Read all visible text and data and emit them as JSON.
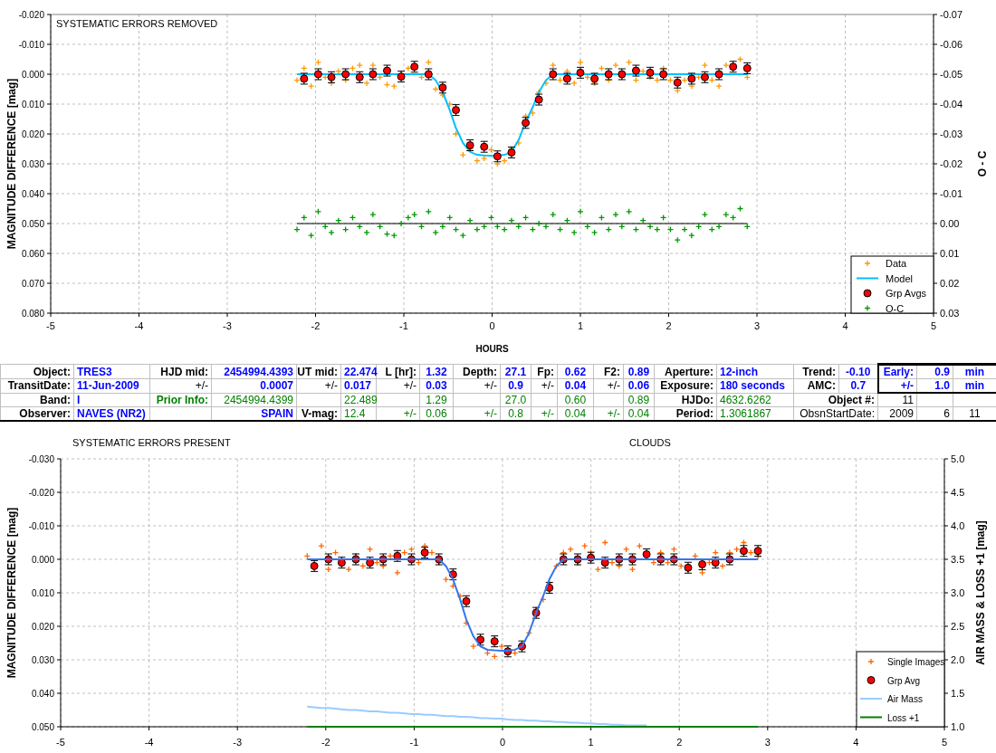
{
  "chart_top": {
    "chart_data": {
      "type": "scatter",
      "xlabel": "HOURS",
      "ylabel": "MAGNITUDE DIFFERENCE [mag]",
      "xlim": [
        -5,
        5
      ],
      "ylim": [
        0.08,
        -0.02
      ],
      "xticks": [
        -5,
        -4,
        -3,
        -2,
        -1,
        0,
        1,
        2,
        3,
        4,
        5
      ],
      "yticks": [
        {
          "value": -0.02,
          "label": "-0.020"
        },
        {
          "value": -0.01,
          "label": "-0.010"
        },
        {
          "value": 0,
          "label": "0.000"
        },
        {
          "value": 0.01,
          "label": "0.010"
        },
        {
          "value": 0.02,
          "label": "0.020"
        },
        {
          "value": 0.03,
          "label": "0.030"
        },
        {
          "value": 0.04,
          "label": "0.040"
        },
        {
          "value": 0.05,
          "label": "0.050"
        },
        {
          "value": 0.06,
          "label": "0.060"
        },
        {
          "value": 0.07,
          "label": "0.070"
        },
        {
          "value": 0.08,
          "label": "0.080"
        }
      ],
      "y2label": "O - C",
      "y2lim": [
        0.03,
        -0.07
      ],
      "y2ticks": [
        {
          "value": -0.07,
          "label": "-0.07"
        },
        {
          "value": -0.06,
          "label": "-0.06"
        },
        {
          "value": -0.05,
          "label": "-0.05"
        },
        {
          "value": -0.04,
          "label": "-0.04"
        },
        {
          "value": -0.03,
          "label": "-0.03"
        },
        {
          "value": -0.02,
          "label": "-0.02"
        },
        {
          "value": -0.01,
          "label": "-0.01"
        },
        {
          "value": 0,
          "label": "0.00"
        },
        {
          "value": 0.01,
          "label": "0.01"
        },
        {
          "value": 0.02,
          "label": "0.02"
        },
        {
          "value": 0.03,
          "label": "0.03"
        }
      ],
      "annotations": [
        {
          "text": "SYSTEMATIC ERRORS REMOVED"
        }
      ],
      "grid": true,
      "legend": true,
      "ref_lines": [
        {
          "axis": "y2",
          "value": 0
        }
      ],
      "x": [
        -2.21,
        -2.13,
        -2.05,
        -1.97,
        -1.89,
        -1.82,
        -1.74,
        -1.66,
        -1.58,
        -1.5,
        -1.42,
        -1.35,
        -1.27,
        -1.19,
        -1.11,
        -1.03,
        -0.95,
        -0.88,
        -0.8,
        -0.72,
        -0.64,
        -0.56,
        -0.48,
        -0.41,
        -0.33,
        -0.25,
        -0.17,
        -0.09,
        -0.01,
        0.06,
        0.14,
        0.22,
        0.3,
        0.38,
        0.46,
        0.53,
        0.61,
        0.69,
        0.77,
        0.85,
        0.93,
        1.0,
        1.08,
        1.16,
        1.24,
        1.32,
        1.4,
        1.47,
        1.55,
        1.63,
        1.71,
        1.79,
        1.87,
        1.94,
        2.02,
        2.1,
        2.18,
        2.26,
        2.34,
        2.41,
        2.49,
        2.57,
        2.65,
        2.73,
        2.81,
        2.89
      ],
      "series": [
        {
          "name": "Data",
          "type": "scatter",
          "marker": "plus",
          "color": "#ff9900",
          "values": [
            0.002,
            -0.002,
            0.004,
            -0.004,
            0.001,
            0.003,
            -0.001,
            0.002,
            -0.002,
            -0.003,
            0.003,
            -0.003,
            0.001,
            0.0035,
            0.004,
            0.0,
            -0.002,
            -0.003,
            0.001,
            -0.004,
            0.005,
            0.007,
            0.01,
            0.02,
            0.027,
            0.025,
            0.029,
            0.0282,
            0.0253,
            0.03,
            0.029,
            0.025,
            0.023,
            0.014,
            0.013,
            0.006,
            0.003,
            -0.003,
            0.002,
            -0.001,
            0.003,
            -0.004,
            0.001,
            0.003,
            -0.002,
            0.002,
            -0.003,
            0.001,
            -0.004,
            0.002,
            -0.001,
            0.001,
            0.002,
            -0.002,
            0.002,
            0.0055,
            0.002,
            0.004,
            0.001,
            -0.003,
            0.002,
            0.004,
            -0.003,
            -0.002,
            -0.005,
            0.001
          ]
        },
        {
          "name": "Model",
          "type": "line",
          "color": "#00bfff",
          "values": [
            0,
            0,
            0,
            0,
            0,
            0,
            0,
            0,
            0,
            0,
            0,
            0,
            0,
            0,
            0,
            0,
            0,
            0,
            0,
            0,
            0.002,
            0.006,
            0.012,
            0.018,
            0.023,
            0.026,
            0.027,
            0.0272,
            0.0273,
            0.0273,
            0.027,
            0.026,
            0.022,
            0.016,
            0.011,
            0.006,
            0.002,
            0,
            0,
            0,
            0,
            0,
            0,
            0,
            0,
            0,
            0,
            0,
            0,
            0,
            0,
            0,
            0,
            0,
            0,
            0,
            0,
            0,
            0,
            0,
            0,
            0,
            0,
            0,
            0,
            0
          ]
        },
        {
          "name": "Grp Avgs",
          "type": "scatter",
          "marker": "circle",
          "color": "#ff0000",
          "values": [
            null,
            0.0015,
            null,
            0,
            null,
            0.001,
            null,
            0,
            null,
            0.001,
            null,
            0,
            null,
            -0.0012,
            null,
            0.0008,
            null,
            -0.0025,
            null,
            0,
            null,
            0.0045,
            null,
            0.012,
            null,
            0.0238,
            null,
            0.0243,
            null,
            0.0275,
            null,
            0.0262,
            null,
            0.0163,
            null,
            0.0085,
            null,
            0,
            null,
            0.0015,
            null,
            -0.0005,
            null,
            0.0015,
            null,
            0,
            null,
            0,
            null,
            -0.0012,
            null,
            -0.0005,
            null,
            0,
            null,
            0.0028,
            null,
            0.0015,
            null,
            0.001,
            null,
            0,
            null,
            -0.0025,
            null,
            -0.002
          ]
        },
        {
          "name": "O-C",
          "type": "scatter",
          "marker": "plus",
          "axis": "y2",
          "color": "#009900",
          "values": [
            0.002,
            -0.002,
            0.004,
            -0.004,
            0.001,
            0.003,
            -0.001,
            0.002,
            -0.002,
            0.001,
            0.003,
            -0.003,
            0.001,
            0.0035,
            0.004,
            0.0,
            -0.002,
            -0.003,
            0.001,
            -0.004,
            0.003,
            0.001,
            -0.002,
            0.002,
            0.004,
            -0.001,
            0.002,
            0.001,
            -0.002,
            0.001,
            0.002,
            -0.001,
            0.001,
            -0.002,
            0.002,
            0.0,
            0.001,
            -0.003,
            0.002,
            -0.001,
            0.003,
            -0.004,
            0.001,
            0.003,
            -0.002,
            0.002,
            -0.003,
            0.001,
            -0.004,
            0.002,
            -0.001,
            0.001,
            0.002,
            -0.002,
            0.002,
            0.0055,
            0.002,
            0.004,
            0.001,
            -0.003,
            0.002,
            0.001,
            -0.003,
            -0.002,
            -0.005,
            0.001
          ]
        }
      ]
    }
  },
  "info_table": {
    "rows": [
      [
        {
          "text": "Object:",
          "kind": "label"
        },
        {
          "text": "TRES3",
          "kind": "value"
        },
        {
          "text": "HJD mid:",
          "kind": "label"
        },
        {
          "text": "2454994.4393",
          "kind": "value"
        },
        {
          "text": "UT mid:",
          "kind": "label"
        },
        {
          "text": "22.474",
          "kind": "value"
        },
        {
          "text": "L [hr]:",
          "kind": "label"
        },
        {
          "text": "1.32",
          "kind": "value"
        },
        {
          "text": "Depth:",
          "kind": "label"
        },
        {
          "text": "27.1",
          "kind": "value"
        },
        {
          "text": "Fp:",
          "kind": "label"
        },
        {
          "text": "0.62",
          "kind": "value"
        },
        {
          "text": "F2:",
          "kind": "label"
        },
        {
          "text": "0.89",
          "kind": "value"
        },
        {
          "text": "Aperture:",
          "kind": "label"
        },
        {
          "text": "12-inch",
          "kind": "value"
        },
        {
          "text": "Trend:",
          "kind": "label"
        },
        {
          "text": "-0.10",
          "kind": "value"
        },
        {
          "text": "Early:",
          "kind": "value",
          "boxed": true
        },
        {
          "text": "0.9",
          "kind": "value",
          "boxed": true
        },
        {
          "text": "min",
          "kind": "value",
          "boxed": true
        }
      ],
      [
        {
          "text": "TransitDate:",
          "kind": "label"
        },
        {
          "text": "11-Jun-2009",
          "kind": "value"
        },
        {
          "text": "+/-",
          "kind": "plain"
        },
        {
          "text": "0.0007",
          "kind": "value"
        },
        {
          "text": "+/-",
          "kind": "plain"
        },
        {
          "text": "0.017",
          "kind": "value"
        },
        {
          "text": "+/-",
          "kind": "plain"
        },
        {
          "text": "0.03",
          "kind": "value"
        },
        {
          "text": "+/-",
          "kind": "plain"
        },
        {
          "text": "0.9",
          "kind": "value"
        },
        {
          "text": "+/-",
          "kind": "plain"
        },
        {
          "text": "0.04",
          "kind": "value"
        },
        {
          "text": "+/-",
          "kind": "plain"
        },
        {
          "text": "0.06",
          "kind": "value"
        },
        {
          "text": "Exposure:",
          "kind": "label"
        },
        {
          "text": "180 seconds",
          "kind": "value"
        },
        {
          "text": "AMC:",
          "kind": "label"
        },
        {
          "text": "0.7",
          "kind": "value"
        },
        {
          "text": "+/-",
          "kind": "value",
          "boxed": true
        },
        {
          "text": "1.0",
          "kind": "value",
          "boxed": true
        },
        {
          "text": "min",
          "kind": "value",
          "boxed": true
        }
      ],
      [
        {
          "text": "Band:",
          "kind": "label"
        },
        {
          "text": "I",
          "kind": "value"
        },
        {
          "text": "Prior Info:",
          "kind": "prior_label"
        },
        {
          "text": "2454994.4399",
          "kind": "prior"
        },
        {},
        {
          "text": "22.489",
          "kind": "prior"
        },
        {},
        {
          "text": "1.29",
          "kind": "prior"
        },
        {},
        {
          "text": "27.0",
          "kind": "prior"
        },
        {},
        {
          "text": "0.60",
          "kind": "prior"
        },
        {},
        {
          "text": "0.89",
          "kind": "prior"
        },
        {
          "text": "HJDo:",
          "kind": "label"
        },
        {
          "text": "4632.6262",
          "kind": "prior"
        },
        {
          "text": "Object #:",
          "kind": "label",
          "colspan": 2
        },
        {
          "text": "11",
          "kind": "plain"
        },
        {},
        {}
      ],
      [
        {
          "text": "Observer:",
          "kind": "label"
        },
        {
          "text": "NAVES (NR2)",
          "kind": "value"
        },
        {},
        {
          "text": "SPAIN",
          "kind": "value"
        },
        {
          "text": "V-mag:",
          "kind": "label"
        },
        {
          "text": "12.4",
          "kind": "prior"
        },
        {
          "text": "+/-",
          "kind": "prior"
        },
        {
          "text": "0.06",
          "kind": "prior"
        },
        {
          "text": "+/-",
          "kind": "prior"
        },
        {
          "text": "0.8",
          "kind": "prior"
        },
        {
          "text": "+/-",
          "kind": "prior"
        },
        {
          "text": "0.04",
          "kind": "prior"
        },
        {
          "text": "+/-",
          "kind": "prior"
        },
        {
          "text": "0.04",
          "kind": "prior"
        },
        {
          "text": "Period:",
          "kind": "label"
        },
        {
          "text": "1.3061867",
          "kind": "prior"
        },
        {
          "text": "ObsnStartDate:",
          "kind": "plain",
          "colspan": 2
        },
        {
          "text": "2009",
          "kind": "plain"
        },
        {
          "text": "6",
          "kind": "plain"
        },
        {
          "text": "11",
          "kind": "plain"
        }
      ]
    ]
  },
  "chart_bottom": {
    "chart_data": {
      "type": "scatter",
      "ylabel": "MAGNITUDE DIFFERENCE [mag]",
      "xlim": [
        -5,
        5
      ],
      "ylim": [
        0.05,
        -0.03
      ],
      "xticks": [
        -5,
        -4,
        -3,
        -2,
        -1,
        0,
        1,
        2,
        3,
        4,
        5
      ],
      "yticks": [
        {
          "value": -0.03,
          "label": "-0.030"
        },
        {
          "value": -0.02,
          "label": "-0.020"
        },
        {
          "value": -0.01,
          "label": "-0.010"
        },
        {
          "value": 0,
          "label": "0.000"
        },
        {
          "value": 0.01,
          "label": "0.010"
        },
        {
          "value": 0.02,
          "label": "0.020"
        },
        {
          "value": 0.03,
          "label": "0.030"
        },
        {
          "value": 0.04,
          "label": "0.040"
        },
        {
          "value": 0.05,
          "label": "0.050"
        }
      ],
      "y2label": "AIR MASS & LOSS +1 [mag]",
      "y2lim": [
        1,
        5
      ],
      "y2ticks": [
        {
          "value": 5,
          "label": "5.0"
        },
        {
          "value": 4.5,
          "label": "4.5"
        },
        {
          "value": 4,
          "label": "4.0"
        },
        {
          "value": 3.5,
          "label": "3.5"
        },
        {
          "value": 3,
          "label": "3.0"
        },
        {
          "value": 2.5,
          "label": "2.5"
        },
        {
          "value": 2,
          "label": "2.0"
        },
        {
          "value": 1.5,
          "label": "1.5"
        },
        {
          "value": 1,
          "label": "1.0"
        }
      ],
      "annotations": [
        {
          "text": "SYSTEMATIC ERRORS PRESENT"
        },
        {
          "text": "CLOUDS"
        }
      ],
      "grid": true,
      "legend": true,
      "x": [
        -2.21,
        -2.13,
        -2.05,
        -1.97,
        -1.89,
        -1.82,
        -1.74,
        -1.66,
        -1.58,
        -1.5,
        -1.42,
        -1.35,
        -1.27,
        -1.19,
        -1.11,
        -1.03,
        -0.95,
        -0.88,
        -0.8,
        -0.72,
        -0.64,
        -0.56,
        -0.48,
        -0.41,
        -0.33,
        -0.25,
        -0.17,
        -0.09,
        -0.01,
        0.06,
        0.14,
        0.22,
        0.3,
        0.38,
        0.46,
        0.53,
        0.61,
        0.69,
        0.77,
        0.85,
        0.93,
        1.0,
        1.08,
        1.16,
        1.24,
        1.32,
        1.4,
        1.47,
        1.55,
        1.63,
        1.71,
        1.79,
        1.87,
        1.94,
        2.02,
        2.1,
        2.18,
        2.26,
        2.34,
        2.41,
        2.49,
        2.57,
        2.65,
        2.73,
        2.81,
        2.89
      ],
      "series": [
        {
          "name": "Single Images",
          "type": "scatter",
          "marker": "plus",
          "color": "#ff6600",
          "values": [
            -0.001,
            0.002,
            -0.004,
            0.003,
            -0.002,
            0.001,
            0.003,
            -0.001,
            0.002,
            -0.003,
            0.001,
            0.002,
            -0.001,
            0.004,
            -0.002,
            -0.003,
            0.001,
            -0.004,
            -0.002,
            0.001,
            0.006,
            0.008,
            0.011,
            0.019,
            0.026,
            0.024,
            0.028,
            0.029,
            0.026,
            0.027,
            0.028,
            0.026,
            0.022,
            0.015,
            0.012,
            0.007,
            0.002,
            -0.002,
            -0.003,
            0.001,
            -0.004,
            -0.002,
            0.003,
            -0.005,
            0.001,
            0.002,
            -0.003,
            0.003,
            -0.004,
            -0.001,
            0.001,
            -0.002,
            0.001,
            -0.003,
            0.002,
            0.003,
            -0.001,
            0.004,
            0.001,
            -0.002,
            0.002,
            -0.002,
            -0.003,
            -0.005,
            -0.002,
            -0.001
          ]
        },
        {
          "name": "Grp Avg",
          "type": "scatter",
          "marker": "circle",
          "color": "#ff0000",
          "values": [
            null,
            0.002,
            null,
            0,
            null,
            0.001,
            null,
            0,
            null,
            0.001,
            null,
            0,
            null,
            -0.001,
            null,
            0,
            null,
            -0.002,
            null,
            0,
            null,
            0.0045,
            null,
            0.0125,
            null,
            0.024,
            null,
            0.0245,
            null,
            0.0275,
            null,
            0.026,
            null,
            0.016,
            null,
            0.0085,
            null,
            0,
            null,
            0,
            null,
            -0.0005,
            null,
            0.001,
            null,
            0,
            null,
            0,
            null,
            -0.0015,
            null,
            0,
            null,
            0,
            null,
            0.0025,
            null,
            0.0015,
            null,
            0.001,
            null,
            0,
            null,
            -0.0025,
            null,
            -0.0025
          ]
        },
        {
          "type": "line",
          "color": "#3377ee",
          "values": [
            0,
            0,
            0,
            0,
            0,
            0,
            0,
            0,
            0,
            0,
            0,
            0,
            0,
            0,
            0,
            0,
            0,
            0,
            0,
            0,
            0.002,
            0.006,
            0.012,
            0.018,
            0.023,
            0.026,
            0.027,
            0.0272,
            0.0273,
            0.0273,
            0.027,
            0.026,
            0.022,
            0.016,
            0.011,
            0.006,
            0.002,
            0,
            0,
            0,
            0,
            0,
            0,
            0,
            0,
            0,
            0,
            0,
            0,
            0,
            0,
            0,
            0,
            0,
            0,
            0,
            0,
            0,
            0,
            0,
            0,
            0,
            0,
            0,
            0,
            0
          ]
        },
        {
          "name": "Air Mass",
          "type": "line",
          "axis": "y2",
          "color": "#99ccff",
          "values": [
            1.3,
            1.29,
            1.28,
            1.28,
            1.27,
            1.26,
            1.25,
            1.25,
            1.24,
            1.23,
            1.23,
            1.22,
            1.21,
            1.21,
            1.2,
            1.19,
            1.19,
            1.18,
            1.18,
            1.17,
            1.16,
            1.16,
            1.15,
            1.15,
            1.14,
            1.13,
            1.13,
            1.12,
            1.12,
            1.11,
            1.1,
            1.1,
            1.09,
            1.09,
            1.08,
            1.08,
            1.07,
            1.07,
            1.06,
            1.06,
            1.05,
            1.05,
            1.04,
            1.04,
            1.03,
            1.03,
            1.02,
            1.02,
            1.02,
            1.02,
            null,
            null,
            null,
            null,
            null,
            null,
            null,
            null,
            null,
            null,
            null,
            null,
            null,
            null,
            null,
            null
          ]
        },
        {
          "name": "Loss +1",
          "type": "line",
          "axis": "y2",
          "color": "#008000",
          "values": [
            1,
            1,
            1,
            1,
            1,
            1,
            1,
            1,
            1,
            1,
            1,
            1,
            1,
            1,
            1,
            1,
            1,
            1,
            1,
            1,
            1,
            1,
            1,
            1,
            1,
            1,
            1,
            1,
            1,
            1,
            1,
            1,
            1,
            1,
            1,
            1,
            1,
            1,
            1,
            1,
            1,
            1,
            1,
            1,
            1,
            1,
            1,
            1,
            1,
            1,
            1,
            1,
            1,
            1,
            1,
            1,
            1,
            1,
            1,
            1,
            1,
            1,
            1,
            1,
            1,
            1
          ]
        }
      ]
    }
  }
}
